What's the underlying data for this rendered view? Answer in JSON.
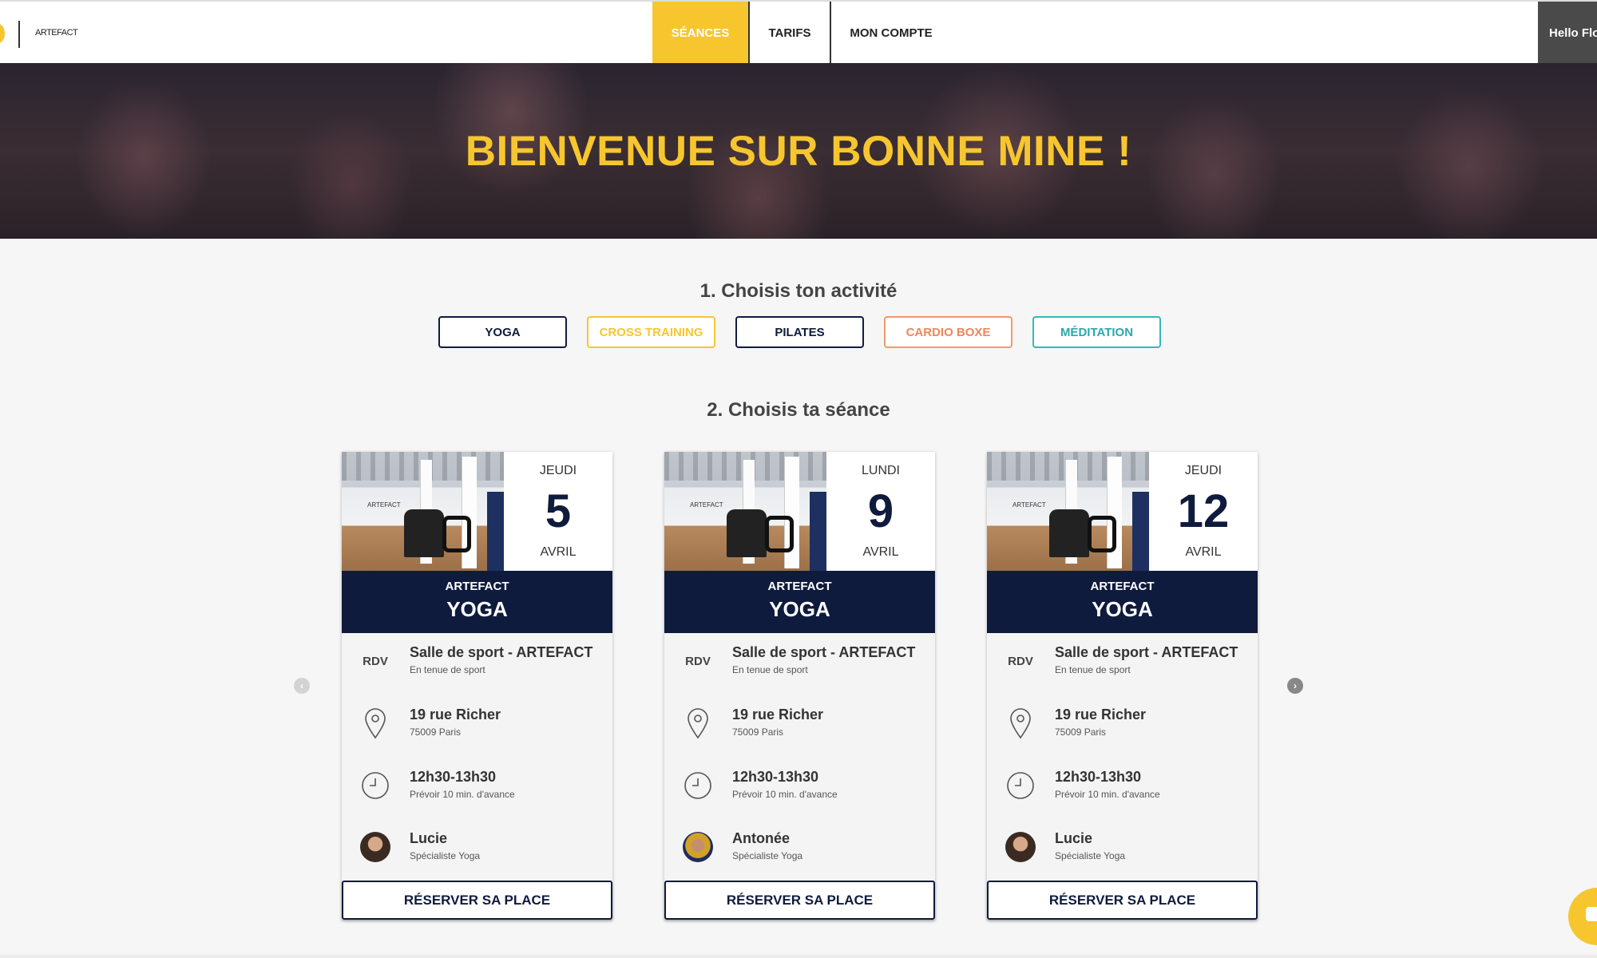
{
  "header": {
    "logo_text": "ARTEFACT",
    "nav": [
      {
        "label": "SÉANCES",
        "active": true
      },
      {
        "label": "TARIFS",
        "active": false
      },
      {
        "label": "MON COMPTE",
        "active": false
      }
    ],
    "hello_text": "Hello Flo"
  },
  "hero": {
    "title": "BIENVENUE SUR BONNE MINE !"
  },
  "step1": {
    "title": "1. Choisis ton activité",
    "activities": [
      "YOGA",
      "CROSS TRAINING",
      "PILATES",
      "CARDIO BOXE",
      "MÉDITATION"
    ]
  },
  "step2": {
    "title": "2. Choisis ta séance"
  },
  "cards": [
    {
      "photo_text": "ARTEFACT",
      "day": "JEUDI",
      "date": "5",
      "month": "AVRIL",
      "venue": "ARTEFACT",
      "activity": "YOGA",
      "rdv_label": "RDV",
      "rdv_main": "Salle de sport - ARTEFACT",
      "rdv_sub": "En tenue de sport",
      "address_main": "19 rue Richer",
      "address_sub": "75009 Paris",
      "time_main": "12h30-13h30",
      "time_sub": "Prévoir 10 min. d'avance",
      "coach_name": "Lucie",
      "coach_role": "Spécialiste Yoga",
      "button": "RÉSERVER SA PLACE"
    },
    {
      "photo_text": "ARTEFACT",
      "day": "LUNDI",
      "date": "9",
      "month": "AVRIL",
      "venue": "ARTEFACT",
      "activity": "YOGA",
      "rdv_label": "RDV",
      "rdv_main": "Salle de sport - ARTEFACT",
      "rdv_sub": "En tenue de sport",
      "address_main": "19 rue Richer",
      "address_sub": "75009 Paris",
      "time_main": "12h30-13h30",
      "time_sub": "Prévoir 10 min. d'avance",
      "coach_name": "Antonée",
      "coach_role": "Spécialiste Yoga",
      "button": "RÉSERVER SA PLACE"
    },
    {
      "photo_text": "ARTEFACT",
      "day": "JEUDI",
      "date": "12",
      "month": "AVRIL",
      "venue": "ARTEFACT",
      "activity": "YOGA",
      "rdv_label": "RDV",
      "rdv_main": "Salle de sport - ARTEFACT",
      "rdv_sub": "En tenue de sport",
      "address_main": "19 rue Richer",
      "address_sub": "75009 Paris",
      "time_main": "12h30-13h30",
      "time_sub": "Prévoir 10 min. d'avance",
      "coach_name": "Lucie",
      "coach_role": "Spécialiste Yoga",
      "button": "RÉSERVER SA PLACE"
    }
  ],
  "carousel": {
    "prev_icon": "chevron-left-icon",
    "next_icon": "chevron-right-icon"
  },
  "colors": {
    "accent": "#f7c62f",
    "navy": "#0f1b3d",
    "cardio": "#f0865a",
    "meditation": "#2aa9ad"
  }
}
